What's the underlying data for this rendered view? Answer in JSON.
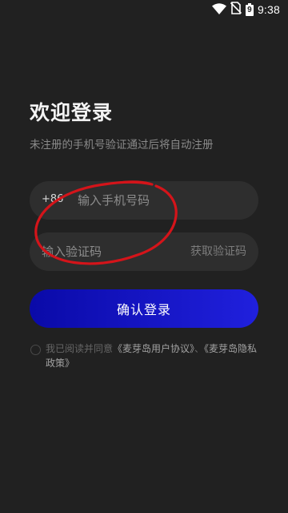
{
  "status_bar": {
    "time": "9:38",
    "battery_level": "9",
    "icons": [
      "wifi-icon",
      "no-sim-icon",
      "battery-icon"
    ]
  },
  "login": {
    "title": "欢迎登录",
    "subtitle": "未注册的手机号验证通过后将自动注册",
    "country_code": "+86",
    "phone_placeholder": "输入手机号码",
    "code_placeholder": "输入验证码",
    "get_code_label": "获取验证码",
    "confirm_label": "确认登录"
  },
  "agreement": {
    "prefix": "我已阅读并同意",
    "user_agreement": "《麦芽岛用户协议》",
    "separator": "、",
    "privacy_policy": "《麦芽岛隐私政策》"
  },
  "colors": {
    "background": "#212121",
    "input_bg": "#2e2e2e",
    "button_accent": "#1414c8",
    "annotation": "#d4141a"
  }
}
